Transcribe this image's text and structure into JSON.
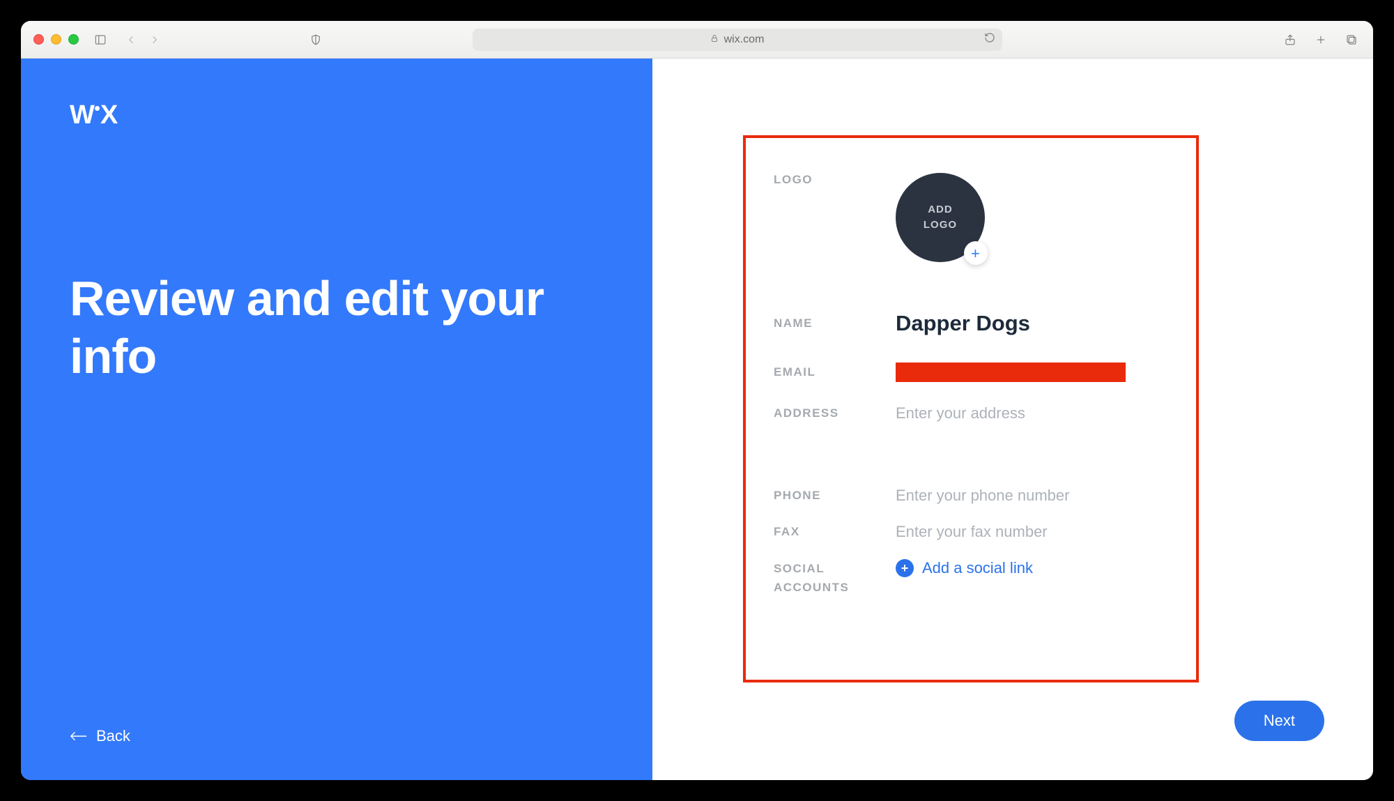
{
  "browser": {
    "url_host": "wix.com"
  },
  "brand": "WiX",
  "headline": "Review and edit your info",
  "back_label": "Back",
  "next_label": "Next",
  "form": {
    "logo": {
      "label": "LOGO",
      "upload_line1": "ADD",
      "upload_line2": "LOGO"
    },
    "name": {
      "label": "NAME",
      "value": "Dapper Dogs"
    },
    "email": {
      "label": "EMAIL"
    },
    "address": {
      "label": "ADDRESS",
      "placeholder": "Enter your address"
    },
    "phone": {
      "label": "PHONE",
      "placeholder": "Enter your phone number"
    },
    "fax": {
      "label": "FAX",
      "placeholder": "Enter your fax number"
    },
    "social": {
      "label": "SOCIAL ACCOUNTS",
      "link_text": "Add a social link"
    }
  }
}
